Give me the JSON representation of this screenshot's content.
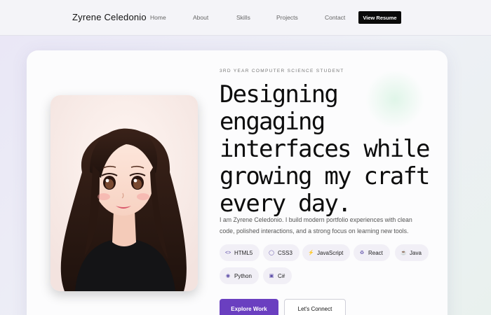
{
  "navbar": {
    "brand": "Zyrene Celedonio",
    "links": [
      "Home",
      "About",
      "Skills",
      "Projects",
      "Contact"
    ],
    "cta": "View Resume"
  },
  "hero": {
    "eyebrow": "3RD YEAR COMPUTER SCIENCE STUDENT",
    "headline_lines": [
      "Designing",
      "engaging",
      "interfaces while",
      "growing my craft",
      "every day."
    ],
    "intro_lines": [
      "I am Zyrene Celedonio. I build modern portfolio experiences with clean",
      "code, polished interactions, and a strong focus on learning new tools."
    ],
    "skills": [
      {
        "label": "HTML5",
        "icon": "code-icon"
      },
      {
        "label": "CSS3",
        "icon": "css-icon"
      },
      {
        "label": "JavaScript",
        "icon": "bolt-icon"
      },
      {
        "label": "React",
        "icon": "atom-icon"
      },
      {
        "label": "Java",
        "icon": "coffee-icon"
      },
      {
        "label": "Python",
        "icon": "python-icon"
      },
      {
        "label": "C#",
        "icon": "csharp-icon"
      }
    ],
    "primary_button": "Explore Work",
    "secondary_button": "Let's Connect"
  },
  "colors": {
    "accent": "#6a3fc0",
    "dark_button": "#0a0a0a",
    "chip_bg": "#f1eff6"
  }
}
